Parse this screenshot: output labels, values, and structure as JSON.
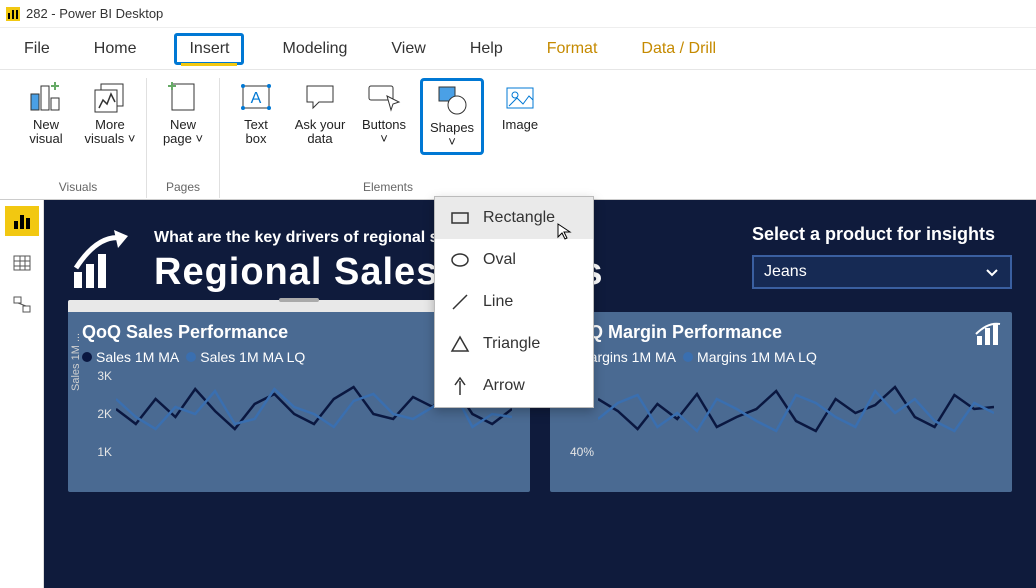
{
  "window": {
    "title": "282 - Power BI Desktop"
  },
  "menu": {
    "file": "File",
    "home": "Home",
    "insert": "Insert",
    "modeling": "Modeling",
    "view": "View",
    "help": "Help",
    "format": "Format",
    "datadrill": "Data / Drill"
  },
  "ribbon": {
    "groups": {
      "visuals": {
        "label": "Visuals",
        "new_visual": "New\nvisual",
        "more_visuals": "More\nvisuals ˅"
      },
      "pages": {
        "label": "Pages",
        "new_page": "New\npage ˅"
      },
      "elements": {
        "label": "Elements",
        "text_box": "Text\nbox",
        "ask_data": "Ask your\ndata",
        "buttons": "Buttons\n˅",
        "shapes": "Shapes\n˅",
        "image": "Image"
      }
    }
  },
  "shapes_menu": {
    "rectangle": "Rectangle",
    "oval": "Oval",
    "line": "Line",
    "triangle": "Triangle",
    "arrow": "Arrow"
  },
  "report": {
    "subtitle": "What are the key drivers of regional success?",
    "title": "Regional Sales Insights",
    "selector_label": "Select a product for insights",
    "selector_value": "Jeans",
    "card1": {
      "title": "QoQ Sales Performance",
      "legend1": "Sales 1M MA",
      "legend2": "Sales 1M MA LQ",
      "ylabel": "Sales 1M ...",
      "ticks": [
        "3K",
        "2K",
        "1K"
      ]
    },
    "card2": {
      "title": "QoQ Margin Performance",
      "legend1": "Margins 1M MA",
      "legend2": "Margins 1M MA LQ",
      "ylabel": "Margins 1M ...",
      "ticks": [
        "50%",
        "40%"
      ]
    }
  },
  "chart_data": [
    {
      "type": "line",
      "title": "QoQ Sales Performance",
      "ylabel": "Sales 1M ...",
      "ylim": [
        1000,
        3000
      ],
      "series": [
        {
          "name": "Sales 1M MA",
          "values": [
            2000,
            1800,
            2200,
            1900,
            2400,
            2000,
            1700,
            2100,
            2300,
            2000,
            1800,
            2200,
            2400,
            2000,
            1900,
            2300,
            2100,
            2500,
            2000,
            1800
          ]
        },
        {
          "name": "Sales 1M MA LQ",
          "values": [
            2200,
            1900,
            1700,
            2100,
            2000,
            2300,
            1800,
            1900,
            2400,
            2100,
            2000,
            1800,
            2200,
            2300,
            2000,
            1900,
            2100,
            2400,
            1800,
            2000
          ]
        }
      ]
    },
    {
      "type": "line",
      "title": "QoQ Margin Performance",
      "ylabel": "Margins 1M ...",
      "ylim": [
        30,
        55
      ],
      "series": [
        {
          "name": "Margins 1M MA",
          "values": [
            45,
            42,
            38,
            44,
            40,
            46,
            39,
            41,
            43,
            47,
            40,
            38,
            45,
            42,
            44,
            48,
            41,
            39,
            46,
            43
          ]
        },
        {
          "name": "Margins 1M MA LQ",
          "values": [
            40,
            44,
            46,
            39,
            42,
            38,
            45,
            43,
            40,
            38,
            46,
            44,
            41,
            39,
            47,
            42,
            45,
            40,
            38,
            44
          ]
        }
      ]
    }
  ]
}
